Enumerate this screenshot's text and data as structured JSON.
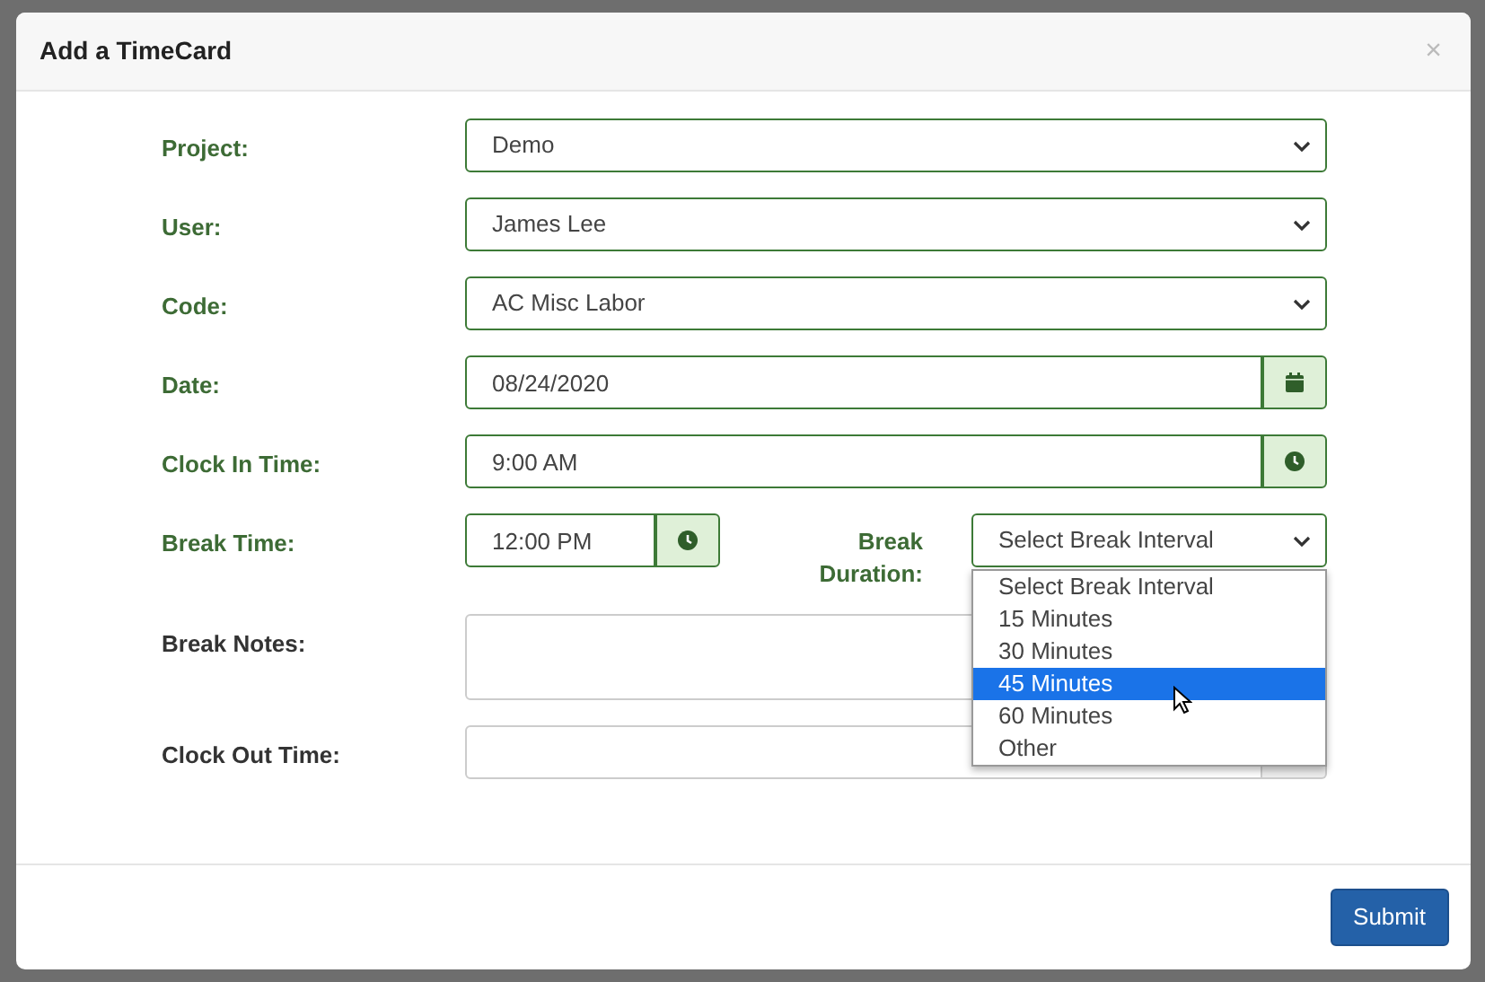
{
  "dialog": {
    "title": "Add a TimeCard",
    "close": "×"
  },
  "fields": [
    {
      "label": "Project:",
      "kind": "select",
      "value": "Demo",
      "valid": true
    },
    {
      "label": "User:",
      "kind": "select",
      "value": "James Lee",
      "valid": true
    },
    {
      "label": "Code:",
      "kind": "select",
      "value": "AC Misc Labor",
      "valid": true
    },
    {
      "label": "Date:",
      "kind": "date",
      "value": "08/24/2020",
      "valid": true
    },
    {
      "label": "Clock In Time:",
      "kind": "time",
      "value": "9:00 AM",
      "valid": true
    }
  ],
  "break": {
    "label": "Break Time:",
    "value": "12:00 PM",
    "valid": true,
    "duration_label": "Break Duration:",
    "duration_value": "Select Break Interval",
    "duration_valid": true,
    "expanded": true,
    "options": [
      {
        "label": "Select Break Interval",
        "selected": false
      },
      {
        "label": "15 Minutes",
        "selected": false
      },
      {
        "label": "30 Minutes",
        "selected": false
      },
      {
        "label": "45 Minutes",
        "selected": true
      },
      {
        "label": "60 Minutes",
        "selected": false
      },
      {
        "label": "Other",
        "selected": false
      }
    ]
  },
  "notes": {
    "label": "Break Notes:",
    "valid": false
  },
  "clock_out": {
    "label": "Clock Out Time:",
    "valid": false
  },
  "submit": "Submit"
}
